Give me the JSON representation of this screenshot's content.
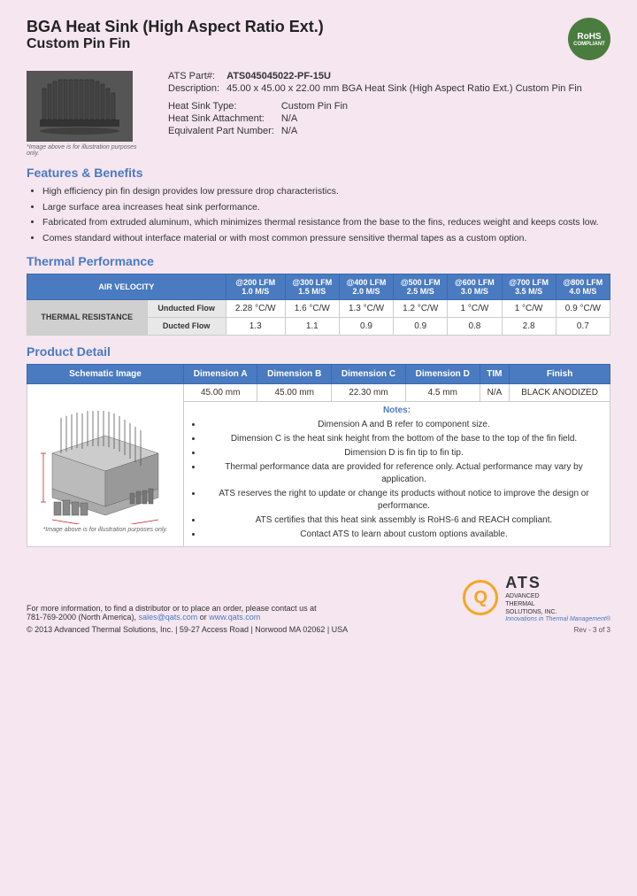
{
  "header": {
    "title_line1": "BGA Heat Sink (High Aspect Ratio Ext.)",
    "title_line2": "Custom Pin Fin",
    "rohs": "RoHS\nCOMPLIANT"
  },
  "product": {
    "part_label": "ATS Part#:",
    "part_number": "ATS045045022-PF-15U",
    "desc_label": "Description:",
    "description": "45.00 x 45.00 x 22.00 mm  BGA Heat Sink (High Aspect Ratio Ext.) Custom Pin Fin",
    "type_label": "Heat Sink Type:",
    "type_value": "Custom Pin Fin",
    "attachment_label": "Heat Sink Attachment:",
    "attachment_value": "N/A",
    "equiv_label": "Equivalent Part Number:",
    "equiv_value": "N/A",
    "image_caption": "*Image above is for illustration purposes only."
  },
  "features": {
    "section_title": "Features & Benefits",
    "items": [
      "High efficiency pin fin design provides low pressure drop characteristics.",
      "Large surface area increases heat sink performance.",
      "Fabricated from extruded aluminum, which minimizes thermal resistance from the base to the fins, reduces weight and keeps costs low.",
      "Comes standard without interface material or with most common pressure sensitive thermal tapes as a custom option."
    ]
  },
  "thermal": {
    "section_title": "Thermal Performance",
    "header_col0": "AIR VELOCITY",
    "headers": [
      "@200 LFM\n1.0 M/S",
      "@300 LFM\n1.5 M/S",
      "@400 LFM\n2.0 M/S",
      "@500 LFM\n2.5 M/S",
      "@600 LFM\n3.0 M/S",
      "@700 LFM\n3.5 M/S",
      "@800 LFM\n4.0 M/S"
    ],
    "row_label": "THERMAL RESISTANCE",
    "rows": [
      {
        "label": "Unducted Flow",
        "values": [
          "2.28 °C/W",
          "1.6 °C/W",
          "1.3 °C/W",
          "1.2 °C/W",
          "1 °C/W",
          "1 °C/W",
          "0.9 °C/W"
        ]
      },
      {
        "label": "Ducted Flow",
        "values": [
          "1.3",
          "1.1",
          "0.9",
          "0.9",
          "0.8",
          "2.8",
          "0.7"
        ]
      }
    ]
  },
  "product_detail": {
    "section_title": "Product Detail",
    "table_headers": [
      "Schematic Image",
      "Dimension A",
      "Dimension B",
      "Dimension C",
      "Dimension D",
      "TIM",
      "Finish"
    ],
    "dimensions": {
      "a": "45.00 mm",
      "b": "45.00 mm",
      "c": "22.30 mm",
      "d": "4.5 mm",
      "tim": "N/A",
      "finish": "BLACK ANODIZED"
    },
    "schematic_caption": "*Image above is for illustration purposes only.",
    "notes_title": "Notes:",
    "notes": [
      "Dimension A and B refer to component size.",
      "Dimension C is the heat sink height from the bottom of the base to the top of the fin field.",
      "Dimension D is fin tip to fin tip.",
      "Thermal performance data are provided for reference only. Actual performance may vary by application.",
      "ATS reserves the right to update or change its products without notice to improve the design or performance.",
      "ATS certifies that this heat sink assembly is RoHS-6 and REACH compliant.",
      "Contact ATS to learn about custom options available."
    ]
  },
  "footer": {
    "contact_text": "For more information, to find a distributor or to place an order, please contact us at",
    "phone": "781-769-2000 (North America),",
    "email": "sales@qats.com",
    "email_connector": "or",
    "website": "www.qats.com",
    "copyright": "© 2013 Advanced Thermal Solutions, Inc.  |  59-27 Access Road  |  Norwood MA  02062  |  USA",
    "ats_name": "ATS",
    "ats_full": "ADVANCED\nTHERMAL\nSOLUTIONS, INC.",
    "ats_tagline": "Innovations in Thermal Management®",
    "page_num": "Rev - 3 of 3"
  }
}
